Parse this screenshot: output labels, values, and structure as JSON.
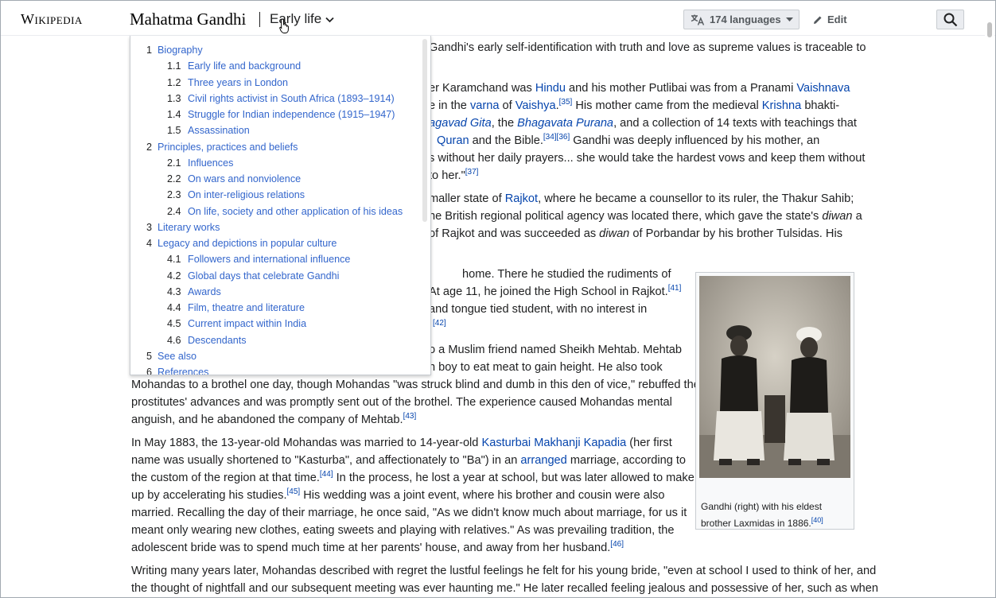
{
  "header": {
    "logo": "Wikipedia",
    "page_title": "Mahatma Gandhi",
    "current_section": "Early life",
    "languages_label": "174 languages",
    "edit_label": "Edit"
  },
  "toc": [
    {
      "num": "1",
      "label": "Biography",
      "level": 1
    },
    {
      "num": "1.1",
      "label": "Early life and background",
      "level": 2
    },
    {
      "num": "1.2",
      "label": "Three years in London",
      "level": 2
    },
    {
      "num": "1.3",
      "label": "Civil rights activist in South Africa (1893–1914)",
      "level": 2
    },
    {
      "num": "1.4",
      "label": "Struggle for Indian independence (1915–1947)",
      "level": 2
    },
    {
      "num": "1.5",
      "label": "Assassination",
      "level": 2
    },
    {
      "num": "2",
      "label": "Principles, practices and beliefs",
      "level": 1
    },
    {
      "num": "2.1",
      "label": "Influences",
      "level": 2
    },
    {
      "num": "2.2",
      "label": "On wars and nonviolence",
      "level": 2
    },
    {
      "num": "2.3",
      "label": "On inter-religious relations",
      "level": 2
    },
    {
      "num": "2.4",
      "label": "On life, society and other application of his ideas",
      "level": 2
    },
    {
      "num": "3",
      "label": "Literary works",
      "level": 1
    },
    {
      "num": "4",
      "label": "Legacy and depictions in popular culture",
      "level": 1
    },
    {
      "num": "4.1",
      "label": "Followers and international influence",
      "level": 2
    },
    {
      "num": "4.2",
      "label": "Global days that celebrate Gandhi",
      "level": 2
    },
    {
      "num": "4.3",
      "label": "Awards",
      "level": 2
    },
    {
      "num": "4.4",
      "label": "Film, theatre and literature",
      "level": 2
    },
    {
      "num": "4.5",
      "label": "Current impact within India",
      "level": 2
    },
    {
      "num": "4.6",
      "label": "Descendants",
      "level": 2
    },
    {
      "num": "5",
      "label": "See also",
      "level": 1
    },
    {
      "num": "6",
      "label": "References",
      "level": 1
    }
  ],
  "content": {
    "p1_l1": "Gandhi's early self-identification with truth and love as supreme values is traceable to",
    "p2_l1a": "er Karamchand was ",
    "hindu": "Hindu",
    "p2_l1b": " and his mother Putlibai was from a Pranami ",
    "vaishnava": "Vaishnava",
    "p2_l2a": "e in the ",
    "varna": "varna",
    "p2_l2b": " of ",
    "vaishya": "Vaishya",
    "ref35": "[35]",
    "p2_l2c": " His mother came from the medieval ",
    "krishna": "Krishna",
    "p2_l2d": " bhakti-",
    "gita": "agavad Gita",
    "p2_l3a": ", the ",
    "purana": "Bhagavata Purana",
    "p2_l3b": ", and a collection of 14 texts with teachings that",
    "quran": "Quran",
    "p2_l4a": " and the Bible.",
    "ref34": "[34][36]",
    "p2_l4b": " Gandhi was deeply influenced by his mother, an",
    "p2_l5": "s without her daily prayers... she would take the hardest vows and keep them without",
    "p2_l6": "to her.\"",
    "ref37": "[37]",
    "p3_l1a": "maller state of ",
    "rajkot": "Rajkot",
    "p3_l1b": ", where he became a counsellor to its ruler, the Thakur Sahib;",
    "p3_l2a": "he British regional political agency was located there, which gave the state's ",
    "diwan": "diwan",
    "p3_l2b": " a",
    "p3_l3a": " of Rajkot and was succeeded as ",
    "diwan2": "diwan",
    "p3_l3b": " of Porbandar by his brother Tulsidas. His",
    "p4_l1": "home. There he studied the rudiments of",
    "p4_l2": "At age 11, he joined the High School in Rajkot.",
    "ref41": "[41]",
    "p4_l3": " and tongue tied student, with no interest in",
    "ref42": "[42]",
    "p5_l1": "o a Muslim friend named Sheikh Mehtab. Mehtab",
    "p5_l2": "n boy to eat meat to gain height. He also took",
    "p5_l3": "Mohandas to a brothel one day, though Mohandas \"was struck blind and dumb in this den of vice,\" rebuffed the",
    "p5_l4": "prostitutes' advances and was promptly sent out of the brothel. The experience caused Mohandas mental",
    "p5_l5": "anguish, and he abandoned the company of Mehtab.",
    "ref43": "[43]",
    "p6_l1a": "In May 1883, the 13-year-old Mohandas was married to 14-year-old ",
    "kasturbai": "Kasturbai Makhanji Kapadia",
    "p6_l1b": " (her first",
    "p6_l2a": "name was usually shortened to \"Kasturba\", and affectionately to \"Ba\") in an ",
    "arranged": "arranged",
    "p6_l2b": " marriage, according to",
    "p6_l3a": "the custom of the region at that time.",
    "ref44": "[44]",
    "p6_l3b": " In the process, he lost a year at school, but was later allowed to make",
    "p6_l4a": "up by accelerating his studies.",
    "ref45": "[45]",
    "p6_l4b": " His wedding was a joint event, where his brother and cousin were also",
    "p6_l5": "married. Recalling the day of their marriage, he once said, \"As we didn't know much about marriage, for us it",
    "p6_l6": "meant only wearing new clothes, eating sweets and playing with relatives.\" As was prevailing tradition, the",
    "p6_l7a": "adolescent bride was to spend much time at her parents' house, and away from her husband.",
    "ref46": "[46]",
    "p7_l1": "Writing many years later, Mohandas described with regret the lustful feelings he felt for his young bride, \"even at school I used to think of her, and",
    "p7_l2": "the thought of nightfall and our subsequent meeting was ever haunting me.\" He later recalled feeling jealous and possessive of her, such as when"
  },
  "figure": {
    "caption": "Gandhi (right) with his eldest brother Laxmidas in 1886.",
    "ref": "[40]"
  },
  "colors": {
    "link": "#0645ad",
    "toc_link": "#3366cc",
    "text": "#202122"
  }
}
